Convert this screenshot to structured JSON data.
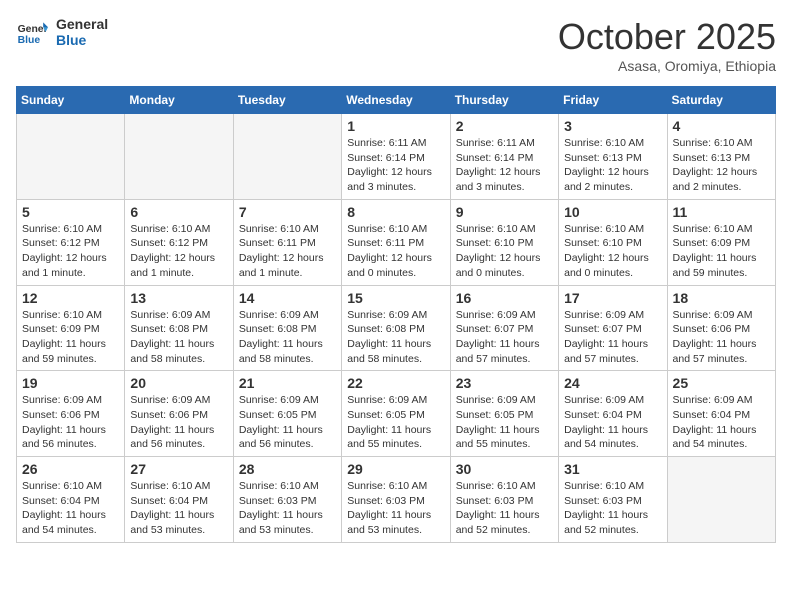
{
  "header": {
    "logo_general": "General",
    "logo_blue": "Blue",
    "month_title": "October 2025",
    "subtitle": "Asasa, Oromiya, Ethiopia"
  },
  "weekdays": [
    "Sunday",
    "Monday",
    "Tuesday",
    "Wednesday",
    "Thursday",
    "Friday",
    "Saturday"
  ],
  "weeks": [
    {
      "days": [
        {
          "number": "",
          "info": "",
          "empty": true
        },
        {
          "number": "",
          "info": "",
          "empty": true
        },
        {
          "number": "",
          "info": "",
          "empty": true
        },
        {
          "number": "1",
          "info": "Sunrise: 6:11 AM\nSunset: 6:14 PM\nDaylight: 12 hours and 3 minutes.",
          "empty": false
        },
        {
          "number": "2",
          "info": "Sunrise: 6:11 AM\nSunset: 6:14 PM\nDaylight: 12 hours and 3 minutes.",
          "empty": false
        },
        {
          "number": "3",
          "info": "Sunrise: 6:10 AM\nSunset: 6:13 PM\nDaylight: 12 hours and 2 minutes.",
          "empty": false
        },
        {
          "number": "4",
          "info": "Sunrise: 6:10 AM\nSunset: 6:13 PM\nDaylight: 12 hours and 2 minutes.",
          "empty": false
        }
      ]
    },
    {
      "days": [
        {
          "number": "5",
          "info": "Sunrise: 6:10 AM\nSunset: 6:12 PM\nDaylight: 12 hours and 1 minute.",
          "empty": false
        },
        {
          "number": "6",
          "info": "Sunrise: 6:10 AM\nSunset: 6:12 PM\nDaylight: 12 hours and 1 minute.",
          "empty": false
        },
        {
          "number": "7",
          "info": "Sunrise: 6:10 AM\nSunset: 6:11 PM\nDaylight: 12 hours and 1 minute.",
          "empty": false
        },
        {
          "number": "8",
          "info": "Sunrise: 6:10 AM\nSunset: 6:11 PM\nDaylight: 12 hours and 0 minutes.",
          "empty": false
        },
        {
          "number": "9",
          "info": "Sunrise: 6:10 AM\nSunset: 6:10 PM\nDaylight: 12 hours and 0 minutes.",
          "empty": false
        },
        {
          "number": "10",
          "info": "Sunrise: 6:10 AM\nSunset: 6:10 PM\nDaylight: 12 hours and 0 minutes.",
          "empty": false
        },
        {
          "number": "11",
          "info": "Sunrise: 6:10 AM\nSunset: 6:09 PM\nDaylight: 11 hours and 59 minutes.",
          "empty": false
        }
      ]
    },
    {
      "days": [
        {
          "number": "12",
          "info": "Sunrise: 6:10 AM\nSunset: 6:09 PM\nDaylight: 11 hours and 59 minutes.",
          "empty": false
        },
        {
          "number": "13",
          "info": "Sunrise: 6:09 AM\nSunset: 6:08 PM\nDaylight: 11 hours and 58 minutes.",
          "empty": false
        },
        {
          "number": "14",
          "info": "Sunrise: 6:09 AM\nSunset: 6:08 PM\nDaylight: 11 hours and 58 minutes.",
          "empty": false
        },
        {
          "number": "15",
          "info": "Sunrise: 6:09 AM\nSunset: 6:08 PM\nDaylight: 11 hours and 58 minutes.",
          "empty": false
        },
        {
          "number": "16",
          "info": "Sunrise: 6:09 AM\nSunset: 6:07 PM\nDaylight: 11 hours and 57 minutes.",
          "empty": false
        },
        {
          "number": "17",
          "info": "Sunrise: 6:09 AM\nSunset: 6:07 PM\nDaylight: 11 hours and 57 minutes.",
          "empty": false
        },
        {
          "number": "18",
          "info": "Sunrise: 6:09 AM\nSunset: 6:06 PM\nDaylight: 11 hours and 57 minutes.",
          "empty": false
        }
      ]
    },
    {
      "days": [
        {
          "number": "19",
          "info": "Sunrise: 6:09 AM\nSunset: 6:06 PM\nDaylight: 11 hours and 56 minutes.",
          "empty": false
        },
        {
          "number": "20",
          "info": "Sunrise: 6:09 AM\nSunset: 6:06 PM\nDaylight: 11 hours and 56 minutes.",
          "empty": false
        },
        {
          "number": "21",
          "info": "Sunrise: 6:09 AM\nSunset: 6:05 PM\nDaylight: 11 hours and 56 minutes.",
          "empty": false
        },
        {
          "number": "22",
          "info": "Sunrise: 6:09 AM\nSunset: 6:05 PM\nDaylight: 11 hours and 55 minutes.",
          "empty": false
        },
        {
          "number": "23",
          "info": "Sunrise: 6:09 AM\nSunset: 6:05 PM\nDaylight: 11 hours and 55 minutes.",
          "empty": false
        },
        {
          "number": "24",
          "info": "Sunrise: 6:09 AM\nSunset: 6:04 PM\nDaylight: 11 hours and 54 minutes.",
          "empty": false
        },
        {
          "number": "25",
          "info": "Sunrise: 6:09 AM\nSunset: 6:04 PM\nDaylight: 11 hours and 54 minutes.",
          "empty": false
        }
      ]
    },
    {
      "days": [
        {
          "number": "26",
          "info": "Sunrise: 6:10 AM\nSunset: 6:04 PM\nDaylight: 11 hours and 54 minutes.",
          "empty": false
        },
        {
          "number": "27",
          "info": "Sunrise: 6:10 AM\nSunset: 6:04 PM\nDaylight: 11 hours and 53 minutes.",
          "empty": false
        },
        {
          "number": "28",
          "info": "Sunrise: 6:10 AM\nSunset: 6:03 PM\nDaylight: 11 hours and 53 minutes.",
          "empty": false
        },
        {
          "number": "29",
          "info": "Sunrise: 6:10 AM\nSunset: 6:03 PM\nDaylight: 11 hours and 53 minutes.",
          "empty": false
        },
        {
          "number": "30",
          "info": "Sunrise: 6:10 AM\nSunset: 6:03 PM\nDaylight: 11 hours and 52 minutes.",
          "empty": false
        },
        {
          "number": "31",
          "info": "Sunrise: 6:10 AM\nSunset: 6:03 PM\nDaylight: 11 hours and 52 minutes.",
          "empty": false
        },
        {
          "number": "",
          "info": "",
          "empty": true
        }
      ]
    }
  ]
}
